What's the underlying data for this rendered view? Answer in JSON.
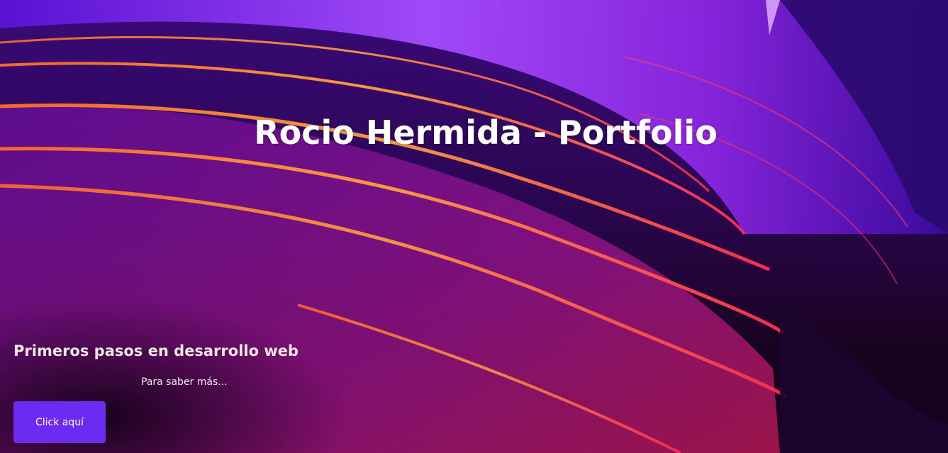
{
  "hero": {
    "title": "Rocio Hermida - Portfolio",
    "subtitle": "Primeros pasos en desarrollo web",
    "more_text": "Para saber más...",
    "button_label": "Click aquí"
  },
  "colors": {
    "button_bg": "#6c2bf0",
    "title_text": "#ffffff",
    "background_dark": "#1a0322",
    "accent_purple": "#8a2cff",
    "accent_orange": "#ff7a2e"
  }
}
